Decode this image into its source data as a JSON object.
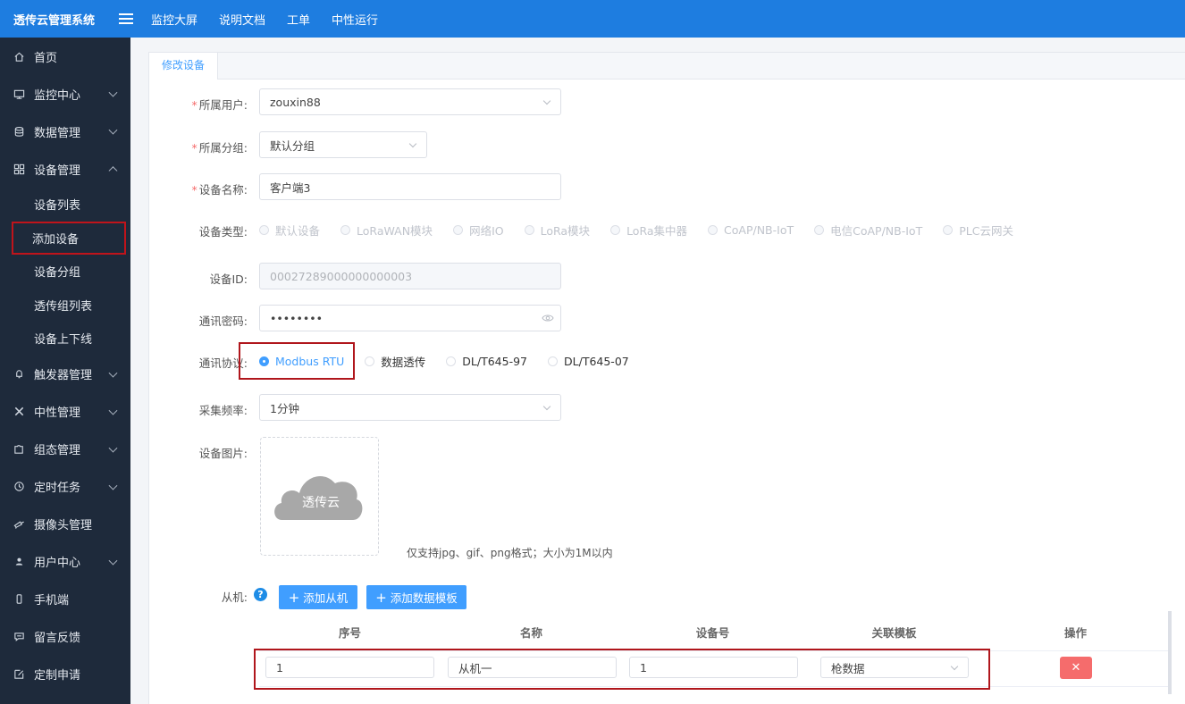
{
  "app": {
    "title": "透传云管理系统"
  },
  "topnav": [
    "监控大屏",
    "说明文档",
    "工单",
    "中性运行"
  ],
  "sidebar": {
    "items": [
      {
        "label": "首页",
        "icon": "home-icon",
        "arrow": ""
      },
      {
        "label": "监控中心",
        "icon": "monitor-icon",
        "arrow": "down"
      },
      {
        "label": "数据管理",
        "icon": "database-icon",
        "arrow": "down"
      },
      {
        "label": "设备管理",
        "icon": "grid-icon",
        "arrow": "up"
      },
      {
        "label": "触发器管理",
        "icon": "bell-icon",
        "arrow": "down"
      },
      {
        "label": "中性管理",
        "icon": "tools-icon",
        "arrow": "down"
      },
      {
        "label": "组态管理",
        "icon": "puzzle-icon",
        "arrow": "down"
      },
      {
        "label": "定时任务",
        "icon": "clock-icon",
        "arrow": "down"
      },
      {
        "label": "摄像头管理",
        "icon": "camera-icon",
        "arrow": ""
      },
      {
        "label": "用户中心",
        "icon": "user-icon",
        "arrow": "down"
      },
      {
        "label": "手机端",
        "icon": "phone-icon",
        "arrow": ""
      },
      {
        "label": "留言反馈",
        "icon": "message-icon",
        "arrow": ""
      },
      {
        "label": "定制申请",
        "icon": "edit-icon",
        "arrow": ""
      }
    ],
    "subitems": [
      "设备列表",
      "添加设备",
      "设备分组",
      "透传组列表",
      "设备上下线"
    ],
    "active_sub": "添加设备"
  },
  "tab": {
    "label": "修改设备"
  },
  "form": {
    "owner": {
      "label": "所属用户:",
      "value": "zouxin88"
    },
    "group": {
      "label": "所属分组:",
      "value": "默认分组"
    },
    "name": {
      "label": "设备名称:",
      "value": "客户端3"
    },
    "type": {
      "label": "设备类型:",
      "options": [
        "默认设备",
        "LoRaWAN模块",
        "网络IO",
        "LoRa模块",
        "LoRa集中器",
        "CoAP/NB-IoT",
        "电信CoAP/NB-IoT",
        "PLC云网关"
      ]
    },
    "device_id": {
      "label": "设备ID:",
      "value": "00027289000000000003"
    },
    "password": {
      "label": "通讯密码:",
      "value": "••••••••"
    },
    "protocol": {
      "label": "通讯协议:",
      "options": [
        "Modbus RTU",
        "数据透传",
        "DL/T645-97",
        "DL/T645-07"
      ],
      "selected": "Modbus RTU"
    },
    "frequency": {
      "label": "采集频率:",
      "value": "1分钟"
    },
    "image": {
      "label": "设备图片:",
      "cloud_text": "透传云",
      "hint": "仅支持jpg、gif、png格式；大小为1M以内"
    },
    "slave": {
      "label": "从机:",
      "help": "?",
      "add_slave": "添加从机",
      "add_template": "添加数据模板"
    }
  },
  "table": {
    "headers": [
      "序号",
      "名称",
      "设备号",
      "关联模板",
      "操作"
    ],
    "rows": [
      {
        "index": "1",
        "name": "从机一",
        "device_no": "1",
        "template": "枪数据",
        "delete": "✕"
      }
    ]
  }
}
